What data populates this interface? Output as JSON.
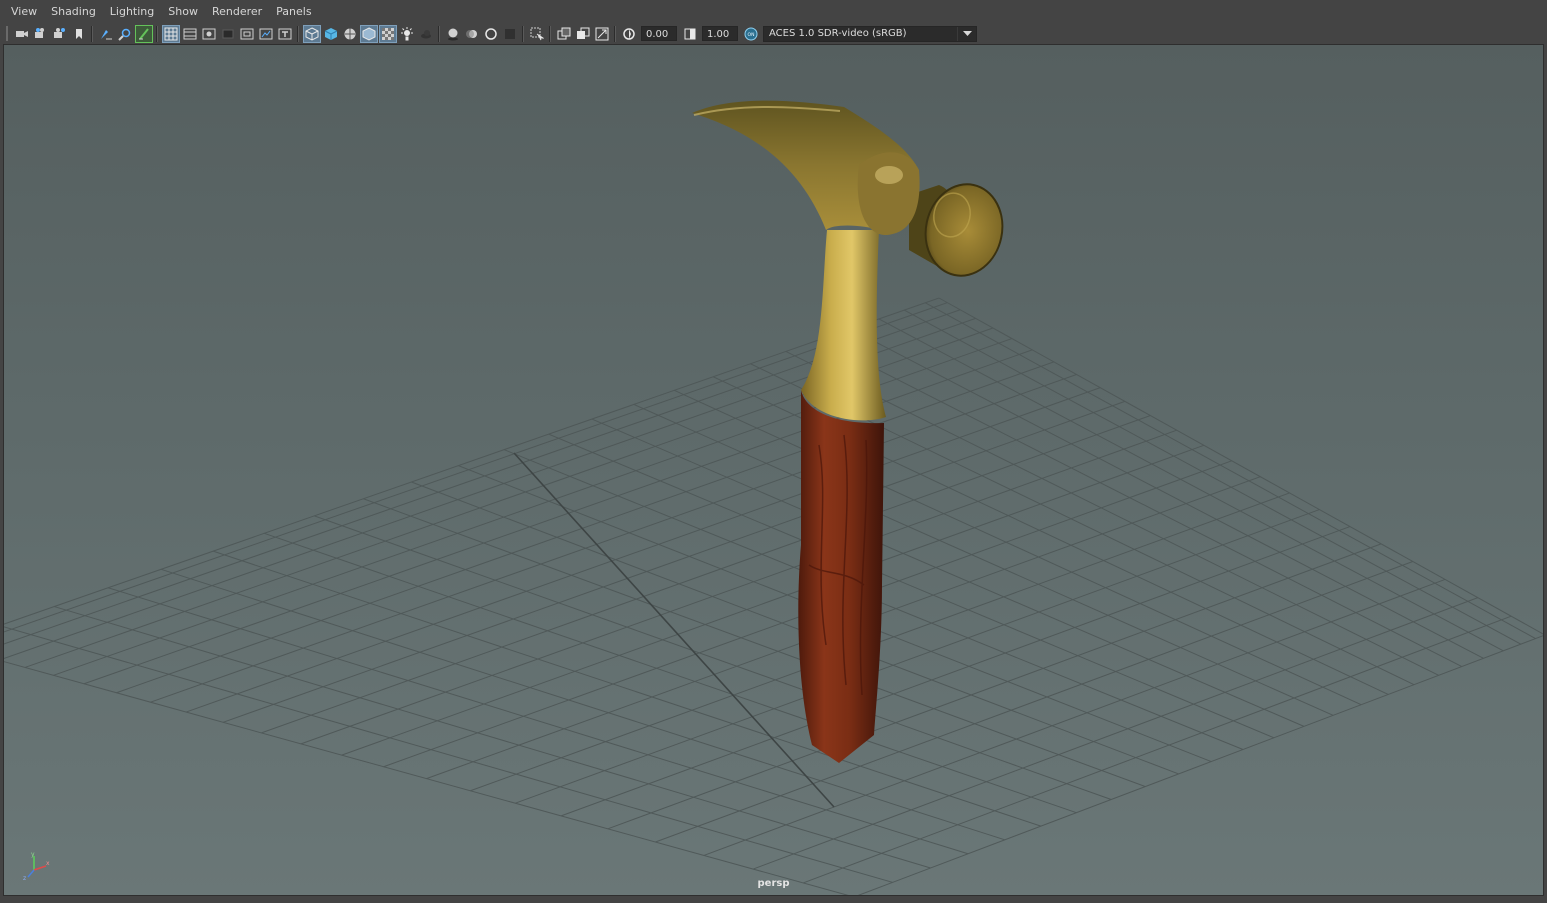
{
  "menu": {
    "items": [
      "View",
      "Shading",
      "Lighting",
      "Show",
      "Renderer",
      "Panels"
    ]
  },
  "toolbar": {
    "exposure_value": "0.00",
    "gamma_value": "1.00",
    "colorspace_badge": "ON",
    "colorspace_value": "ACES 1.0 SDR-video (sRGB)",
    "icons": [
      "select-camera-icon",
      "camera-attributes-icon",
      "bookmarks-icon",
      "image-plane-icon",
      "grease-pencil-icon",
      "2d-pan-zoom-icon",
      "paint-grease-icon",
      "grid-icon",
      "film-gate-icon",
      "resolution-gate-icon",
      "gate-mask-icon",
      "field-chart-icon",
      "safe-action-icon",
      "safe-title-icon",
      "wireframe-icon",
      "smooth-shade-icon",
      "wireframe-on-shaded-icon",
      "xray-icon",
      "xray-joints-icon",
      "use-all-lights-icon",
      "shadows-icon",
      "screen-space-ao-icon",
      "motion-blur-icon",
      "multisample-aa-icon",
      "depth-of-field-icon",
      "isolate-select-icon",
      "xray-active-icon",
      "backface-cull-icon",
      "texture-icon",
      "exposure-icon",
      "gamma-icon",
      "colorspace-icon"
    ]
  },
  "viewport": {
    "camera_label": "persp",
    "axis_labels": {
      "x": "x",
      "y": "y",
      "z": "z"
    }
  },
  "colors": {
    "accent_blue": "#5d7a92",
    "accent_green": "#64c25a",
    "metal": "#b59a3c",
    "wood": "#7a2e17"
  }
}
